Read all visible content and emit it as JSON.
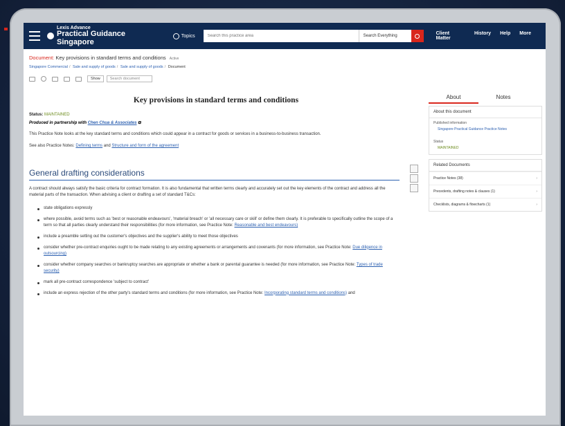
{
  "nav": {
    "brand_small": "Lexis Advance",
    "brand_big": "Practical Guidance Singapore",
    "topics": "Topics",
    "search_placeholder": "Search this practice area",
    "search_scope": "Search Everything",
    "links": [
      "Client Matter",
      "History",
      "Help",
      "More"
    ]
  },
  "doc": {
    "label": "Document:",
    "title": "Key provisions in standard terms and conditions",
    "active": "Active",
    "breadcrumb": [
      "Singapore Commercial",
      "Sale and supply of goods",
      "Sale and supply of goods",
      "Document"
    ],
    "toolbar_label": "Show",
    "toolbar_dropdown": "Search document"
  },
  "content": {
    "heading": "Key provisions in standard terms and conditions",
    "status_label": "Status:",
    "status_value": "MAINTAINED",
    "partner_text": "Produced in partnership with",
    "partner_link": "Chen Chua & Associates",
    "intro": "This Practice Note looks at the key standard terms and conditions which could appear in a contract for goods or services in a business-to-business transaction.",
    "see_also_prefix": "See also Practice Notes:",
    "see_also_link1": "Defining terms",
    "see_also_and": "and",
    "see_also_link2": "Structure and form of the agreement",
    "section_heading": "General drafting considerations",
    "section_para": "A contract should always satisfy the basic criteria for contract formation. It is also fundamental that written terms clearly and accurately set out the key elements of the contract and address all the material parts of the transaction. When advising a client or drafting a set of standard T&Cs:",
    "bullets": [
      {
        "text": "state obligations expressly",
        "link": ""
      },
      {
        "text": "where possible, avoid terms such as 'best or reasonable endeavours', 'material breach' or 'all necessary care or skill' or define them clearly. It is preferable to specifically outline the scope of a term so that all parties clearly understand their responsibilities (for more information, see Practice Note:",
        "link": "Reasonable and best endeavours)"
      },
      {
        "text": "include a preamble setting out the customer's objectives and the supplier's ability to meet those objectives",
        "link": ""
      },
      {
        "text": "consider whether pre-contract enquiries ought to be made relating to any existing agreements or arrangements and covenants (for more information, see Practice Note:",
        "link": "Due diligence in outsourcing)"
      },
      {
        "text": "consider whether company searches or bankruptcy searches are appropriate or whether a bank or parental guarantee is needed (for more information, see Practice Note:",
        "link": "Types of trade security)"
      },
      {
        "text": "mark all pre-contract correspondence 'subject to contract'",
        "link": ""
      },
      {
        "text": "include an express rejection of the other party's standard terms and conditions (for more information, see Practice Note:",
        "link": "Incorporating standard terms and conditions)",
        "tail": "and"
      }
    ]
  },
  "right": {
    "tab_about": "About",
    "tab_notes": "Notes",
    "about_title": "About this document",
    "published_label": "Published information",
    "published_link": "Singapore Practical Guidance Practice Notes",
    "status_label": "Status",
    "status_value": "MAINTAINED",
    "related_title": "Related Documents",
    "related": [
      "Practice Notes (38)",
      "Precedents, drafting notes & clauses (1)",
      "Checklists, diagrams & flowcharts (1)"
    ]
  }
}
